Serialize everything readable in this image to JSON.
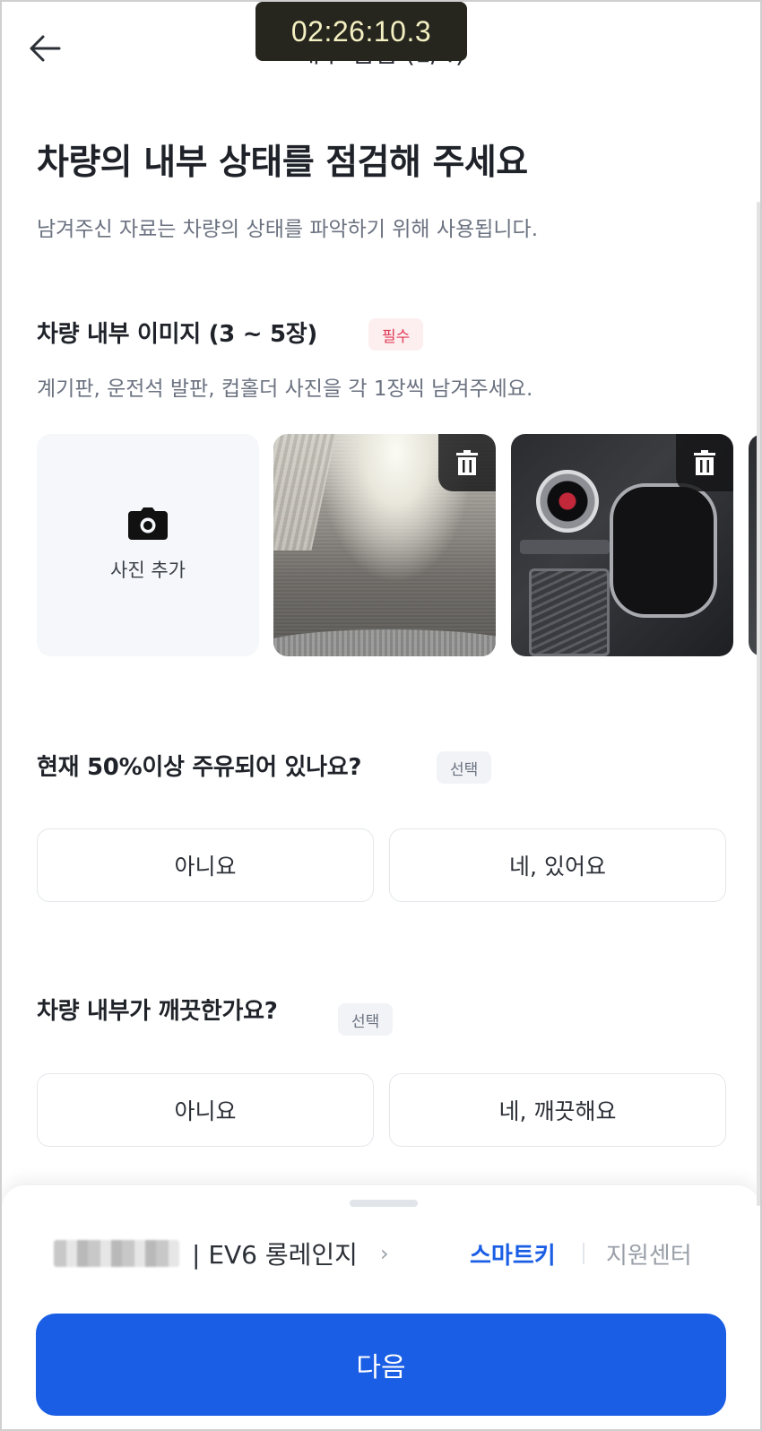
{
  "overlay": {
    "timer": "02:26:10.3"
  },
  "header": {
    "title": "내부 점검 (1/4)",
    "back_icon": "arrow-left-icon"
  },
  "intro": {
    "title": "차량의 내부 상태를 점검해 주세요",
    "subtitle": "남겨주신 자료는 차량의 상태를 파악하기 위해 사용됩니다."
  },
  "images_section": {
    "title": "차량 내부 이미지 (3 ~ 5장)",
    "badge": "필수",
    "description": "계기판, 운전석 발판, 컵홀더 사진을 각 1장씩 남겨주세요.",
    "add_label": "사진 추가"
  },
  "question1": {
    "title": "현재 50%이상 주유되어 있나요?",
    "badge": "선택",
    "options": [
      "아니요",
      "네, 있어요"
    ]
  },
  "question2": {
    "title": "차량 내부가 깨끗한가요?",
    "badge": "선택",
    "options": [
      "아니요",
      "네, 깨끗해요"
    ]
  },
  "bottom": {
    "vehicle": "| EV6 롱레인지",
    "chevron": "›",
    "smartkey": "스마트키",
    "support": "지원센터",
    "next": "다음"
  },
  "colors": {
    "primary": "#1a5ee5",
    "required": "#e03a55"
  }
}
